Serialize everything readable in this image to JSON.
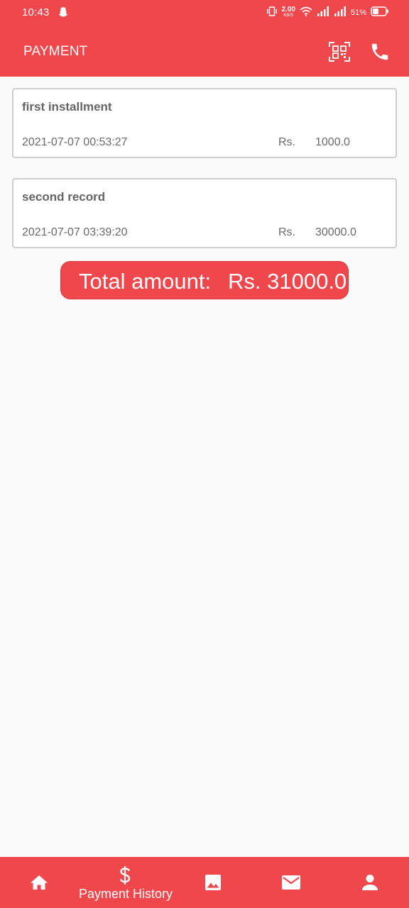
{
  "status_bar": {
    "time": "10:43",
    "net_speed_value": "2.00",
    "net_speed_unit": "KB/S",
    "battery": "51%"
  },
  "app_bar": {
    "title": "PAYMENT",
    "qr_icon": "qr-code-scan-icon",
    "phone_icon": "phone-icon"
  },
  "payments": [
    {
      "title": "first installment",
      "datetime": "2021-07-07 00:53:27",
      "currency": "Rs.",
      "amount": "1000.0"
    },
    {
      "title": "second record",
      "datetime": "2021-07-07 03:39:20",
      "currency": "Rs.",
      "amount": "30000.0"
    }
  ],
  "total": {
    "label": "Total amount:",
    "value": "Rs. 31000.0"
  },
  "bottom_nav": {
    "items": [
      {
        "icon": "home-icon"
      },
      {
        "icon": "dollar-icon",
        "label": "Payment History"
      },
      {
        "icon": "image-icon"
      },
      {
        "icon": "mail-icon"
      },
      {
        "icon": "person-icon"
      }
    ]
  },
  "colors": {
    "primary": "#ef474b",
    "background": "#fafafa",
    "card_border": "#cfcfcf",
    "text_gray": "#666666"
  }
}
